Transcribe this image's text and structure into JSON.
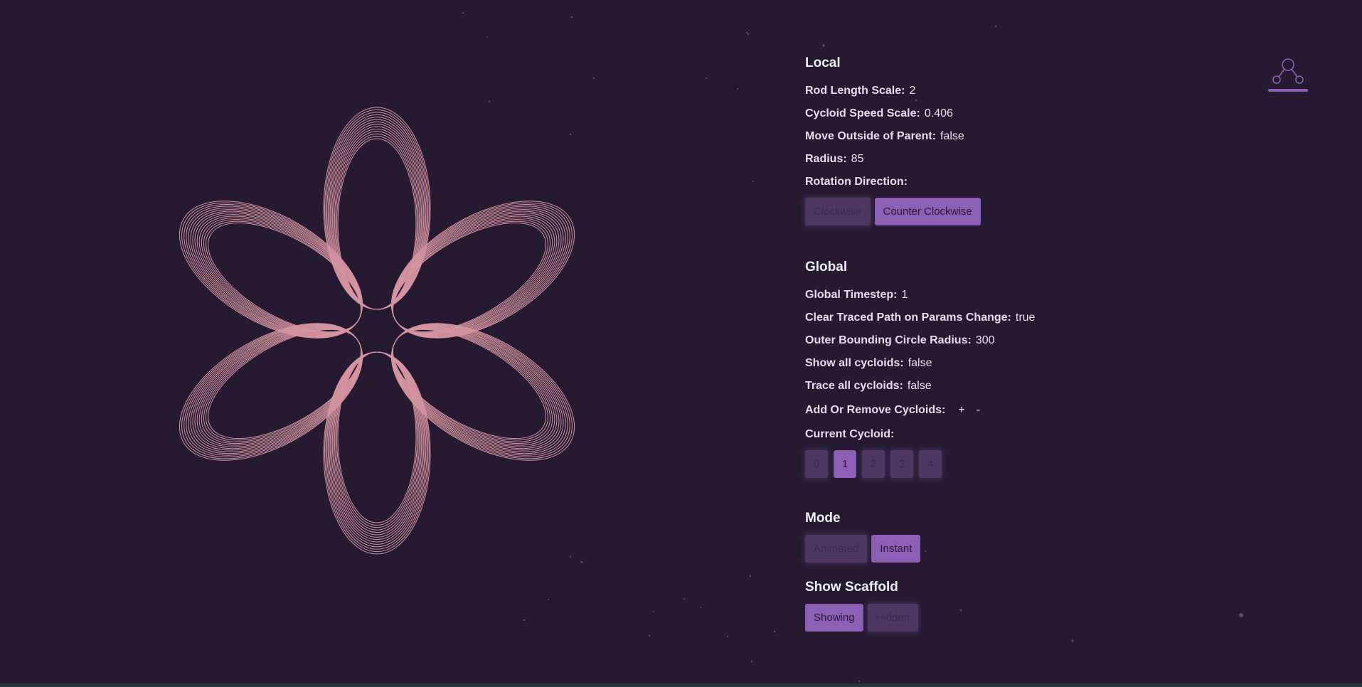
{
  "colors": {
    "background": "#261a33",
    "curve": "#e8a3ad",
    "accent": "#8d5fb4",
    "inactive": "#4e3861"
  },
  "logo": {
    "icon": "nodes-graph-icon"
  },
  "local": {
    "title": "Local",
    "rod_length_scale": {
      "label": "Rod Length Scale:",
      "value": "2"
    },
    "cycloid_speed_scale": {
      "label": "Cycloid Speed Scale:",
      "value": "0.406"
    },
    "move_outside_parent": {
      "label": "Move Outside of Parent:",
      "value": "false"
    },
    "radius": {
      "label": "Radius:",
      "value": "85"
    },
    "rotation_direction": {
      "label": "Rotation Direction:",
      "options": [
        "Clockwise",
        "Counter Clockwise"
      ],
      "selected": "Counter Clockwise"
    }
  },
  "global": {
    "title": "Global",
    "global_timestep": {
      "label": "Global Timestep:",
      "value": "1"
    },
    "clear_traced_path": {
      "label": "Clear Traced Path on Params Change:",
      "value": "true"
    },
    "outer_circle_radius": {
      "label": "Outer Bounding Circle Radius:",
      "value": "300"
    },
    "show_all_cycloids": {
      "label": "Show all cycloids:",
      "value": "false"
    },
    "trace_all_cycloids": {
      "label": "Trace all cycloids:",
      "value": "false"
    },
    "add_remove": {
      "label": "Add Or Remove Cycloids:",
      "add": "+",
      "remove": "-"
    },
    "current_cycloid": {
      "label": "Current Cycloid:",
      "options": [
        "0",
        "1",
        "2",
        "3",
        "4"
      ],
      "selected": "1"
    }
  },
  "mode": {
    "title": "Mode",
    "options": [
      "Animated",
      "Instant"
    ],
    "selected": "Instant"
  },
  "scaffold": {
    "title": "Show Scaffold",
    "options": [
      "Showing",
      "Hidden"
    ],
    "selected": "Showing"
  }
}
